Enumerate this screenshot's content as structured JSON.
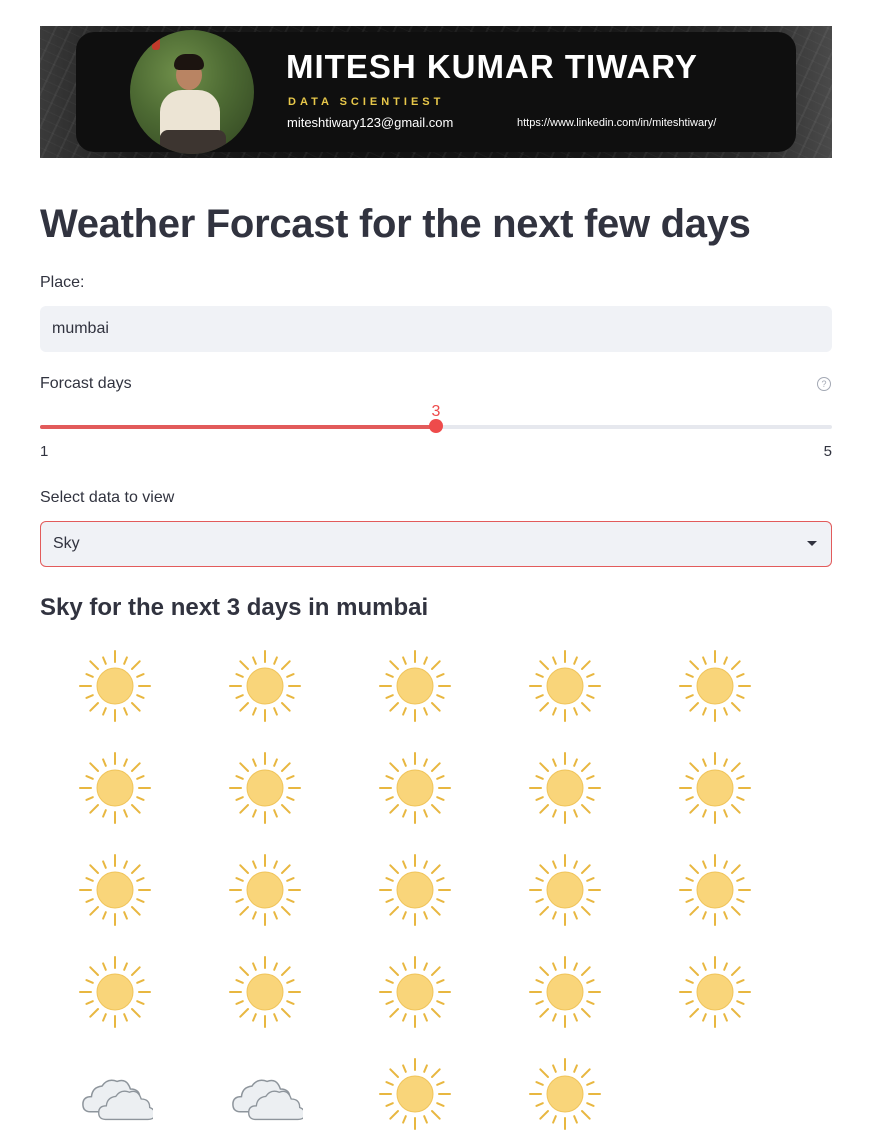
{
  "banner": {
    "name": "MITESH KUMAR TIWARY",
    "role": "DATA SCIENTIEST",
    "email": "miteshtiwary123@gmail.com",
    "linkedin": "https://www.linkedin.com/in/miteshtiwary/"
  },
  "page": {
    "title": "Weather Forcast for the next few days"
  },
  "place": {
    "label": "Place:",
    "value": "mumbai"
  },
  "forecast_slider": {
    "label": "Forcast days",
    "min": 1,
    "max": 5,
    "value": 3,
    "min_label": "1",
    "max_label": "5",
    "value_label": "3",
    "help": "?"
  },
  "data_select": {
    "label": "Select data to view",
    "selected": "Sky"
  },
  "sky_section": {
    "subtitle": "Sky for the next 3 days in mumbai",
    "icons": [
      "sun-icon",
      "sun-icon",
      "sun-icon",
      "sun-icon",
      "sun-icon",
      "sun-icon",
      "sun-icon",
      "sun-icon",
      "sun-icon",
      "sun-icon",
      "sun-icon",
      "sun-icon",
      "sun-icon",
      "sun-icon",
      "sun-icon",
      "sun-icon",
      "sun-icon",
      "sun-icon",
      "sun-icon",
      "sun-icon",
      "cloud-icon",
      "cloud-icon",
      "sun-icon",
      "sun-icon"
    ]
  },
  "colors": {
    "accent": "#ee4b4b",
    "text": "#31333f",
    "input_bg": "#f0f2f6",
    "sun": "#f9d57a",
    "sun_rays": "#e8b740",
    "cloud": "#eceff2"
  }
}
